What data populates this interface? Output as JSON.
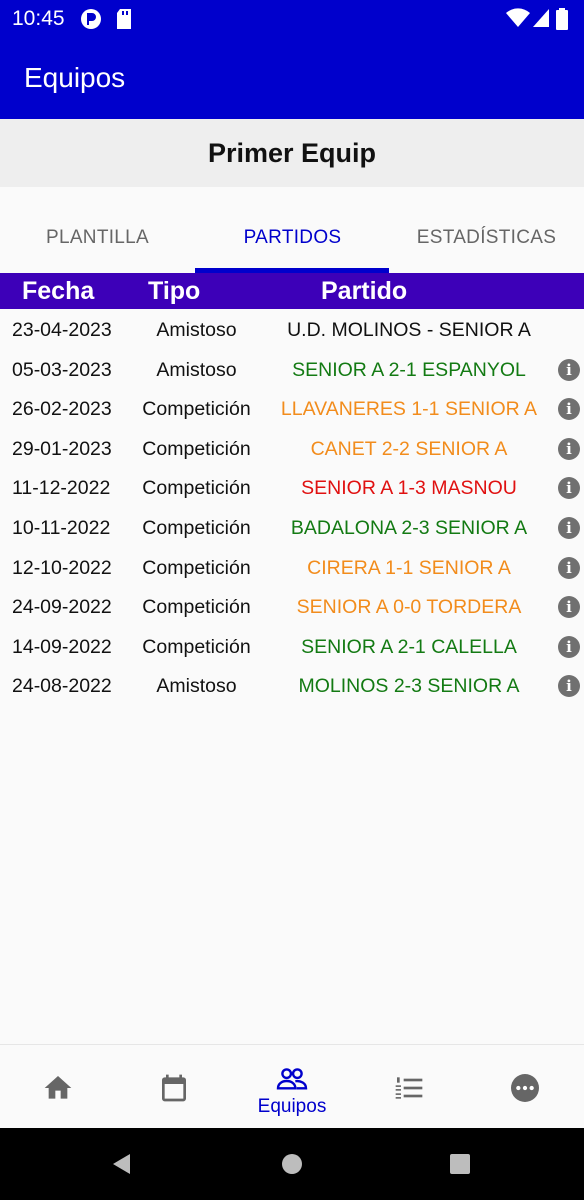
{
  "status_bar": {
    "time": "10:45",
    "icons": [
      "sync-icon",
      "sd-card-icon",
      "wifi-icon",
      "signal-icon",
      "battery-icon"
    ]
  },
  "app_bar": {
    "title": "Equipos"
  },
  "team": {
    "name": "Primer Equip"
  },
  "tabs": [
    {
      "label": "PLANTILLA",
      "active": false
    },
    {
      "label": "PARTIDOS",
      "active": true
    },
    {
      "label": "ESTADÍSTICAS",
      "active": false
    }
  ],
  "table": {
    "headers": {
      "date": "Fecha",
      "type": "Tipo",
      "match": "Partido"
    },
    "rows": [
      {
        "date": "23-04-2023",
        "type": "Amistoso",
        "match": "U.D. MOLINOS - SENIOR A",
        "color": "#111111",
        "info": false
      },
      {
        "date": "05-03-2023",
        "type": "Amistoso",
        "match": "SENIOR A 2-1 ESPANYOL",
        "color": "#137a13",
        "info": true
      },
      {
        "date": "26-02-2023",
        "type": "Competición",
        "match": "LLAVANERES 1-1 SENIOR A",
        "color": "#f28c1c",
        "info": true
      },
      {
        "date": "29-01-2023",
        "type": "Competición",
        "match": "CANET 2-2 SENIOR A",
        "color": "#f28c1c",
        "info": true
      },
      {
        "date": "11-12-2022",
        "type": "Competición",
        "match": "SENIOR A 1-3 MASNOU",
        "color": "#e01010",
        "info": true
      },
      {
        "date": "10-11-2022",
        "type": "Competición",
        "match": "BADALONA 2-3 SENIOR A",
        "color": "#137a13",
        "info": true
      },
      {
        "date": "12-10-2022",
        "type": "Competición",
        "match": "CIRERA 1-1 SENIOR A",
        "color": "#f28c1c",
        "info": true
      },
      {
        "date": "24-09-2022",
        "type": "Competición",
        "match": "SENIOR A 0-0 TORDERA",
        "color": "#f28c1c",
        "info": true
      },
      {
        "date": "14-09-2022",
        "type": "Competición",
        "match": "SENIOR A 2-1 CALELLA",
        "color": "#137a13",
        "info": true
      },
      {
        "date": "24-08-2022",
        "type": "Amistoso",
        "match": "MOLINOS 2-3 SENIOR A",
        "color": "#137a13",
        "info": true
      }
    ]
  },
  "bottom_nav": {
    "items": [
      {
        "icon": "home-icon",
        "label": "",
        "active": false
      },
      {
        "icon": "calendar-icon",
        "label": "",
        "active": false
      },
      {
        "icon": "people-icon",
        "label": "Equipos",
        "active": true
      },
      {
        "icon": "ranking-list-icon",
        "label": "",
        "active": false
      },
      {
        "icon": "more-icon",
        "label": "",
        "active": false
      }
    ]
  },
  "colors": {
    "primary": "#0000cc",
    "table_header": "#3d00b8",
    "win": "#137a13",
    "draw": "#f28c1c",
    "loss": "#e01010"
  }
}
